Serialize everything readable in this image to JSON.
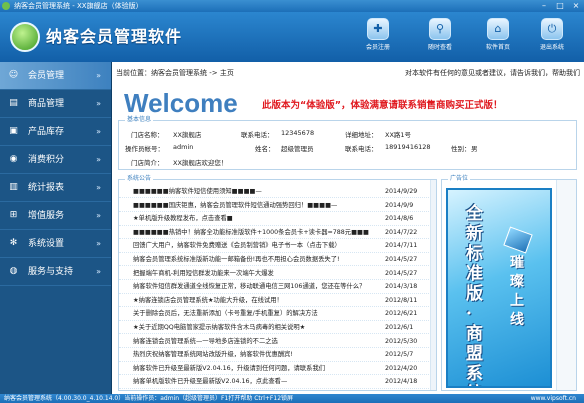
{
  "window": {
    "title": "纳客会员管理系统 - XX旗舰店（体验版）"
  },
  "brand": {
    "name": "纳客会员管理软件"
  },
  "toolbar": [
    {
      "label": "会员注册",
      "icon": "user-add-icon"
    },
    {
      "label": "随时查看",
      "icon": "search-icon"
    },
    {
      "label": "软件首页",
      "icon": "home-icon"
    },
    {
      "label": "退出系统",
      "icon": "exit-icon"
    }
  ],
  "sidebar": {
    "items": [
      {
        "label": "会员管理",
        "icon": "user-icon",
        "active": true
      },
      {
        "label": "商品管理",
        "icon": "document-icon"
      },
      {
        "label": "产品库存",
        "icon": "box-icon"
      },
      {
        "label": "消费积分",
        "icon": "coin-icon"
      },
      {
        "label": "统计报表",
        "icon": "report-icon"
      },
      {
        "label": "增值服务",
        "icon": "plus-icon"
      },
      {
        "label": "系统设置",
        "icon": "gear-icon"
      },
      {
        "label": "服务与支持",
        "icon": "support-icon"
      }
    ]
  },
  "breadcrumb": {
    "text": "当前位置：纳客会员管理系统 -> 主页"
  },
  "notice_line": "对本软件有任何的意见或者建议，请告诉我们，帮助我们",
  "welcome": "Welcome",
  "trial_msg": "此版本为“体验版”，体验满意请联系销售商购买正式版！",
  "basic_info": {
    "title": "基本信息",
    "store_label": "门店名称：",
    "store": "XX旗舰店",
    "phone_label": "联系电话：",
    "phone": "12345678",
    "addr_label": "详细地址：",
    "addr": "XX路1号",
    "account_label": "操作员帐号：",
    "account": "admin",
    "name_label": "姓名：",
    "name": "超级管理员",
    "contact_label": "联系电话：",
    "contact": "18919416128",
    "sex_label": "性别：",
    "sex": "男",
    "intro_label": "门店简介：",
    "intro": "XX旗舰店欢迎您！"
  },
  "notices": {
    "title": "系统公告",
    "rows": [
      {
        "text": "■■■■■■纳客软件短信使用须知■■■■—",
        "date": "2014/9/29"
      },
      {
        "text": "■■■■■■国庆钜惠，纳客会员管理软件短信通动强势回归！■■■■—",
        "date": "2014/9/9"
      },
      {
        "text": "★单机版升级教程发布，点击查看■",
        "date": "2014/8/6"
      },
      {
        "text": "■■■■■■热销中！纳客全功能标准版软件+1000条会员卡+读卡器=788元■■■",
        "date": "2014/7/22"
      },
      {
        "text": "回馈广大用户，纳客软件免费赠送《会员制营销》电子书一本（点击下载）",
        "date": "2014/7/11"
      },
      {
        "text": "纳客会员管理系统标准版新功能一邮箱备份!再也不用担心会员数据丢失了!",
        "date": "2014/5/27"
      },
      {
        "text": "把握端午商机-利用短信群发功能来一次端午大爆发",
        "date": "2014/5/27"
      },
      {
        "text": "纳客软件短信群发通道全线恢复正常，移动联通电信三网106通道，您还在等什么？",
        "date": "2014/3/18"
      },
      {
        "text": "★纳客连锁店会员管理系统★功能大升级，在线试用！",
        "date": "2012/8/11"
      },
      {
        "text": "关于删除会员后，无法重新添加（卡号重复/手机重复）的解决方法",
        "date": "2012/6/21"
      },
      {
        "text": "★关于近期QQ电脑管家提示纳客软件含木马病毒的相关说明★",
        "date": "2012/6/1"
      },
      {
        "text": "纳客连锁会员管理系统—一导地多店连锁的不二之选",
        "date": "2012/5/30"
      },
      {
        "text": "热烈庆祝纳客管理系统网站改版升级，纳客软件优惠酬宾!",
        "date": "2012/5/7"
      },
      {
        "text": "纳客软件已升级至最新版V2.04.16，升级请到任何问题，请联系我们",
        "date": "2012/4/20"
      },
      {
        "text": "纳客单机版软件已升级至最新版V2.04.16，点此查看—",
        "date": "2012/4/18"
      }
    ]
  },
  "ad": {
    "title": "广告位",
    "vertical_text": "全新标准版·商盟系统",
    "side_text": "璀璨上线"
  },
  "status": {
    "left": "纳客会员管理系统（4.00.30.0_4.10.14.0）当前操作员：admin（超级管理员）F1打开帮助 Ctrl+F12锁屏",
    "url": "www.vipsoft.cn"
  },
  "colors": {
    "accent": "#3d81bf",
    "sidebar": "#1c5586",
    "alert": "#e0191f"
  }
}
